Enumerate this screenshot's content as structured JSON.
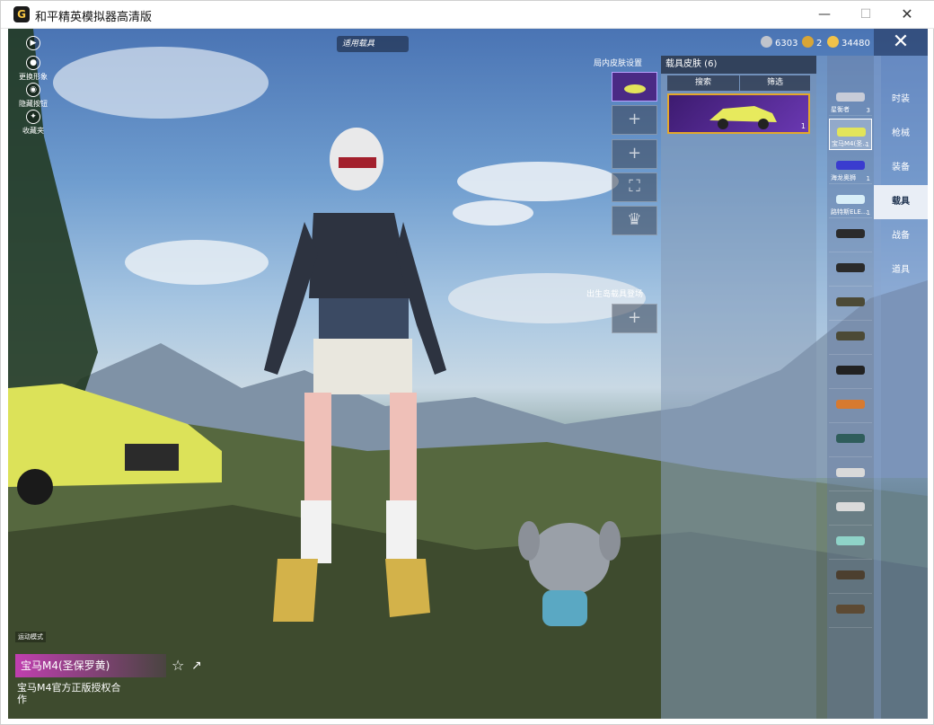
{
  "window": {
    "title": "和平精英模拟器高清版",
    "app_icon": "G",
    "min": "—",
    "max": "☐",
    "close": "✕"
  },
  "hud": {
    "vehicle_tag": "适用载具",
    "currencies": [
      {
        "icon": "silver-coin-icon",
        "value": "6303",
        "color": "#c0c4cc"
      },
      {
        "icon": "gold-coin-icon",
        "value": "2",
        "color": "#d8a536"
      },
      {
        "icon": "gem-icon",
        "value": "34480",
        "color": "#f1c24a"
      }
    ],
    "close": "✕"
  },
  "left_toolbar": [
    {
      "icon": "play-icon",
      "glyph": "▶",
      "label": ""
    },
    {
      "icon": "person-icon",
      "glyph": "●",
      "label": "更换形象"
    },
    {
      "icon": "eye-icon",
      "glyph": "◉",
      "label": "隐藏按钮"
    },
    {
      "icon": "badge-icon",
      "glyph": "✦",
      "label": "收藏夹"
    }
  ],
  "slots": {
    "title": "局内皮肤设置",
    "items": [
      "",
      "+",
      "+",
      "⛶",
      "♛"
    ],
    "section2_title": "出生岛载具登场",
    "section2_item": "+"
  },
  "skin_panel": {
    "title": "载具皮肤 (6)",
    "search": "搜索",
    "filter": "筛选",
    "card_count": "1"
  },
  "vehicles": [
    {
      "name": "星衡者",
      "count": "3",
      "color": "#c8ccd8",
      "selected": false
    },
    {
      "name": "宝马M4(圣...",
      "count": "1",
      "color": "#e2e45a",
      "selected": true
    },
    {
      "name": "海龙奥狮",
      "count": "1",
      "color": "#3a3ccf",
      "selected": false
    },
    {
      "name": "路特斯ELE...",
      "count": "1",
      "color": "#d8eef8",
      "selected": false
    },
    {
      "name": "",
      "count": "",
      "color": "#2b2b2b",
      "selected": false
    },
    {
      "name": "",
      "count": "",
      "color": "#2b2b2b",
      "selected": false
    },
    {
      "name": "",
      "count": "",
      "color": "#4c4a36",
      "selected": false
    },
    {
      "name": "",
      "count": "",
      "color": "#4c4a36",
      "selected": false
    },
    {
      "name": "",
      "count": "",
      "color": "#222222",
      "selected": false
    },
    {
      "name": "",
      "count": "",
      "color": "#d77a30",
      "selected": false
    },
    {
      "name": "",
      "count": "",
      "color": "#2f5d5b",
      "selected": false
    },
    {
      "name": "",
      "count": "",
      "color": "#d9d9d9",
      "selected": false
    },
    {
      "name": "",
      "count": "",
      "color": "#dadada",
      "selected": false
    },
    {
      "name": "",
      "count": "",
      "color": "#8fd3c8",
      "selected": false
    },
    {
      "name": "",
      "count": "",
      "color": "#4c3f2f",
      "selected": false
    },
    {
      "name": "",
      "count": "",
      "color": "#5d4a33",
      "selected": false
    }
  ],
  "tabs": [
    {
      "label": "时装",
      "active": false
    },
    {
      "label": "枪械",
      "active": false
    },
    {
      "label": "装备",
      "active": false
    },
    {
      "label": "载具",
      "active": true
    },
    {
      "label": "战备",
      "active": false
    },
    {
      "label": "道具",
      "active": false
    }
  ],
  "bottom": {
    "mode": "运动模式",
    "item_name": "宝马M4(圣保罗黄)",
    "favorite_icon": "☆",
    "share_icon": "↗",
    "desc": "宝马M4官方正版授权合作"
  }
}
